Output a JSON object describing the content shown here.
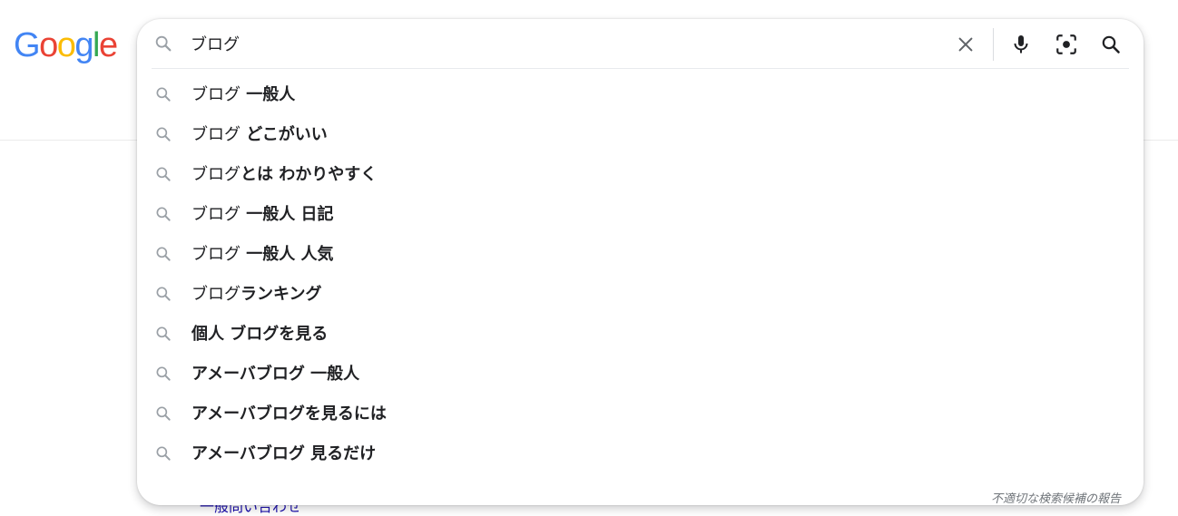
{
  "logo": {
    "letters": [
      "G",
      "o",
      "o",
      "g",
      "l",
      "e"
    ],
    "colors": [
      "#4285F4",
      "#EA4335",
      "#FBBC05",
      "#4285F4",
      "#34A853",
      "#EA4335"
    ]
  },
  "below": {
    "text": "一般問い合わせ"
  },
  "search": {
    "value": "ブログ",
    "clear_icon": "close-icon",
    "mic_icon": "microphone-icon",
    "lens_icon": "camera-lens-icon",
    "search_icon": "search-icon"
  },
  "suggestions": [
    {
      "query": "ブログ",
      "completion": " 一般人"
    },
    {
      "query": "ブログ",
      "completion": " どこがいい"
    },
    {
      "query": "ブログ",
      "completion": "とは わかりやすく"
    },
    {
      "query": "ブログ",
      "completion": " 一般人 日記"
    },
    {
      "query": "ブログ",
      "completion": " 一般人 人気"
    },
    {
      "query": "ブログ",
      "completion": "ランキング"
    },
    {
      "query": "",
      "completion": "個人 ブログを見る"
    },
    {
      "query": "",
      "completion": "アメーバブログ 一般人"
    },
    {
      "query": "",
      "completion": "アメーバブログを見るには"
    },
    {
      "query": "",
      "completion": "アメーバブログ 見るだけ"
    }
  ],
  "report": {
    "label": "不適切な検索候補の報告"
  },
  "colors": {
    "icon_gray": "#9aa0a6",
    "icon_dark": "#5f6368",
    "accent_blue": "#4285F4"
  }
}
